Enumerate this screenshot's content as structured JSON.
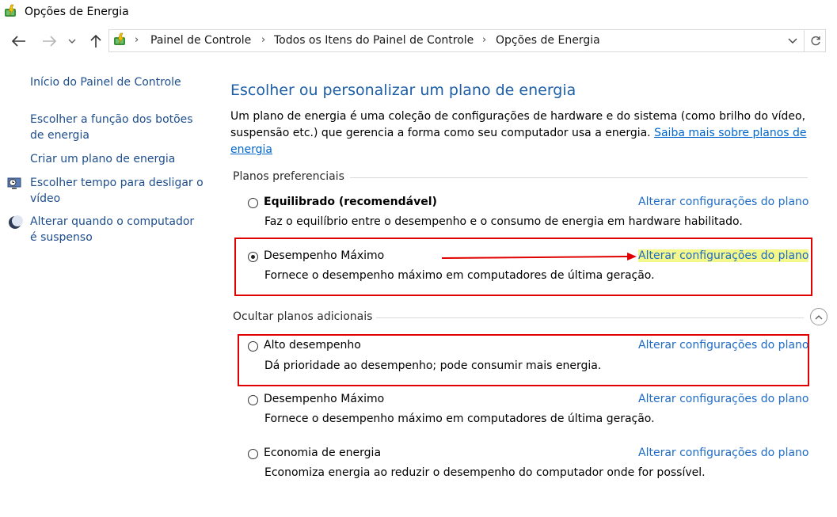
{
  "window": {
    "title": "Opções de Energia"
  },
  "address_bar": {
    "breadcrumbs": [
      "Painel de Controle",
      "Todos os Itens do Painel de Controle",
      "Opções de Energia"
    ]
  },
  "sidebar": {
    "home_link": "Início do Painel de Controle",
    "links": [
      {
        "label": "Escolher a função dos botões de energia",
        "icon": null
      },
      {
        "label": "Criar um plano de energia",
        "icon": null
      },
      {
        "label": "Escolher tempo para desligar o vídeo",
        "icon": "monitor-clock-icon"
      },
      {
        "label": "Alterar quando o computador é suspenso",
        "icon": "moon-icon"
      }
    ]
  },
  "main": {
    "heading": "Escolher ou personalizar um plano de energia",
    "description": "Um plano de energia é uma coleção de configurações de hardware e do sistema (como brilho do vídeo, suspensão etc.) que gerencia a forma como seu computador usa a energia.",
    "learn_more_link": "Saiba mais sobre planos de energia",
    "preferred_group_title": "Planos preferenciais",
    "additional_group_title": "Ocultar planos adicionais",
    "change_settings_label": "Alterar configurações do plano",
    "preferred_plans": [
      {
        "name": "Equilibrado (recomendável)",
        "description": "Faz o equilíbrio entre o desempenho e o consumo de energia em hardware habilitado.",
        "selected": false
      },
      {
        "name": "Desempenho Máximo",
        "description": "Fornece o desempenho máximo em computadores de última geração.",
        "selected": true
      }
    ],
    "additional_plans": [
      {
        "name": "Alto desempenho",
        "description": "Dá prioridade ao desempenho; pode consumir mais energia.",
        "selected": false
      },
      {
        "name": "Desempenho Máximo",
        "description": "Fornece o desempenho máximo em computadores de última geração.",
        "selected": false
      },
      {
        "name": "Economia de energia",
        "description": "Economiza energia ao reduzir o desempenho do computador onde for possível.",
        "selected": false
      }
    ]
  },
  "annotations": {
    "box_color": "#e00000",
    "arrow_color": "#e00000",
    "highlight_color": "#f4f78a"
  }
}
